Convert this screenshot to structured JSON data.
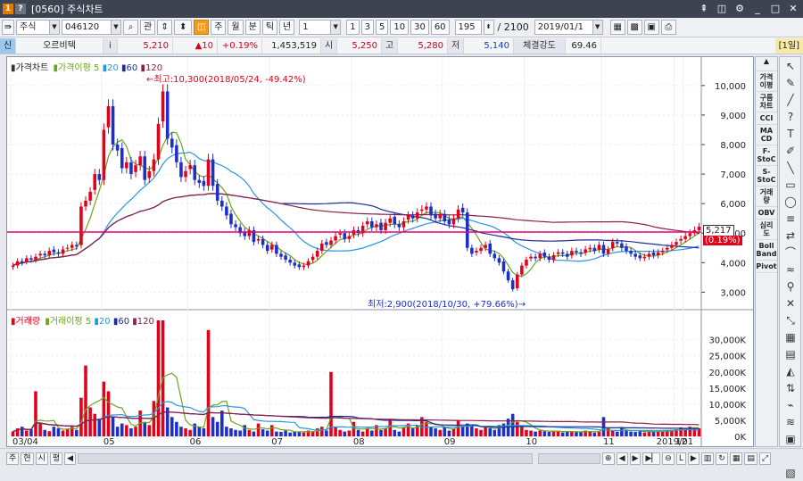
{
  "window": {
    "title": "[0560] 주식차트",
    "title_icon_1": "1",
    "title_icon_2": "?"
  },
  "toolbar": {
    "market": "주식",
    "code": "046120",
    "btn_gwan": "관",
    "periods": [
      "주",
      "월",
      "분",
      "틱",
      "년"
    ],
    "unit_value": "1",
    "minute_buttons": [
      "1",
      "3",
      "5",
      "10",
      "30",
      "60"
    ],
    "count_value": "195",
    "count_total": "/ 2100",
    "date_value": "2019/01/1"
  },
  "info": {
    "tag": "신",
    "name": "오르비텍",
    "i_label": "i",
    "price": "5,210",
    "change": "▲10",
    "change_pct": "+0.19%",
    "volume": "1,453,519",
    "open_label": "시",
    "open": "5,250",
    "high_label": "고",
    "high": "5,280",
    "low_label": "저",
    "low": "5,140",
    "strength_label": "체결강도",
    "strength": "69.46",
    "period_badge": "[1일]"
  },
  "price_panel": {
    "legend": {
      "name": "가격차트",
      "ma_name": "가격이평",
      "ma": [
        "5",
        "20",
        "60",
        "120"
      ]
    },
    "high_note": "←최고:10,300(2018/05/24, -49.42%)",
    "low_note": "최저:2,900(2018/10/30, +79.66%)→",
    "current_price_tag": "5,217",
    "current_pct_tag": "(0.19%)",
    "y_ticks": [
      "10,000",
      "9,000",
      "8,000",
      "7,000",
      "6,000",
      "5,000",
      "4,000",
      "3,000"
    ]
  },
  "volume_panel": {
    "legend": {
      "name": "거래량",
      "ma_name": "거래이평",
      "ma": [
        "5",
        "20",
        "60",
        "120"
      ]
    },
    "y_ticks": [
      "30,000K",
      "25,000K",
      "20,000K",
      "15,000K",
      "10,000K",
      "5,000K",
      "0K"
    ]
  },
  "x_labels": [
    "03/04",
    "05",
    "06",
    "07",
    "08",
    "09",
    "10",
    "11",
    "12",
    "2019/01"
  ],
  "right_tools": [
    "가격\n이평",
    "구름\n차트",
    "CCI",
    "MA\nCD",
    "F-\nStoC",
    "S-\nStoC",
    "거래\n량",
    "OBV",
    "심리\n도",
    "Boll\nBand",
    "Pivot"
  ],
  "drawing_tools": [
    "↖",
    "✎",
    "╱",
    "?",
    "T",
    "✐",
    "╲",
    "▭",
    "◯",
    "≡",
    "⇄",
    "⌒",
    "≈",
    "⚲",
    "✕",
    "⤡",
    "▦",
    "▤",
    "◭",
    "⇅",
    "⌁",
    "≋",
    "▣",
    "▥",
    "▧"
  ],
  "bottom": {
    "tabs": [
      "주",
      "현",
      "시",
      "평"
    ]
  },
  "chart_data": [
    {
      "type": "candlestick",
      "title": "가격차트",
      "ylim": [
        2800,
        10600
      ],
      "start_date": "2018/03/04",
      "end_date": "2019/01",
      "closes": [
        3900,
        4050,
        4000,
        4150,
        4100,
        4200,
        4300,
        4250,
        4400,
        4350,
        4300,
        4450,
        4500,
        4600,
        4550,
        5900,
        6100,
        6400,
        7000,
        6800,
        8500,
        9300,
        8000,
        7800,
        7200,
        7400,
        7000,
        7300,
        7600,
        6800,
        7100,
        7500,
        8700,
        9800,
        8200,
        7900,
        7400,
        6900,
        7100,
        7300,
        6800,
        6700,
        6600,
        7500,
        6600,
        6100,
        5900,
        5600,
        5300,
        5200,
        5000,
        4900,
        5100,
        4700,
        4800,
        4600,
        4400,
        4600,
        4300,
        4200,
        4100,
        4000,
        3900,
        3850,
        3900,
        4050,
        4200,
        4400,
        4650,
        4600,
        4750,
        4900,
        5000,
        4800,
        4900,
        5100,
        5000,
        5250,
        5400,
        5200,
        5300,
        5100,
        5350,
        5500,
        5300,
        5200,
        5400,
        5600,
        5500,
        5700,
        5800,
        5900,
        5600,
        5500,
        5650,
        5400,
        5300,
        5500,
        5800,
        5700,
        4500,
        4300,
        4400,
        4500,
        4600,
        4300,
        4150,
        4000,
        3700,
        3400,
        3100,
        3600,
        3900,
        4100,
        4200,
        4150,
        4300,
        4200,
        4100,
        4250,
        4350,
        4300,
        4200,
        4400,
        4350,
        4300,
        4450,
        4500,
        4400,
        4600,
        4300,
        4450,
        4700,
        4650,
        4500,
        4400,
        4300,
        4200,
        4150,
        4200,
        4300,
        4250,
        4350,
        4400,
        4500,
        4600,
        4700,
        4800,
        4900,
        5000,
        5100,
        5217
      ]
    },
    {
      "type": "bar",
      "title": "거래량",
      "ylim": [
        0,
        36000
      ],
      "values": [
        1500,
        2500,
        3000,
        1800,
        2200,
        14000,
        4000,
        2000,
        1600,
        3000,
        2500,
        1800,
        2400,
        3000,
        2000,
        12000,
        22000,
        9000,
        7000,
        5500,
        17000,
        14000,
        6000,
        3000,
        4000,
        3500,
        2500,
        3000,
        8000,
        4500,
        3500,
        11000,
        36000,
        36000,
        9000,
        6000,
        4500,
        3000,
        2500,
        2000,
        4000,
        3000,
        2500,
        33000,
        6000,
        4500,
        8000,
        3000,
        2500,
        2000,
        1800,
        3500,
        2000,
        1500,
        4000,
        2200,
        1800,
        3500,
        1500,
        1400,
        1800,
        1200,
        1500,
        1300,
        1200,
        1800,
        1500,
        2500,
        3000,
        1800,
        20000,
        3000,
        2000,
        1500,
        1800,
        4500,
        2000,
        1500,
        2500,
        1800,
        3500,
        2000,
        2500,
        5000,
        2000,
        1500,
        2800,
        4000,
        2500,
        3500,
        6000,
        4500,
        3000,
        2500,
        2000,
        3000,
        1800,
        2500,
        5000,
        3000,
        4000,
        3500,
        2500,
        2000,
        3000,
        2500,
        2000,
        3500,
        4000,
        5500,
        7000,
        4500,
        3000,
        2000,
        1800,
        1500,
        1800,
        1600,
        1400,
        1800,
        1500,
        1200,
        1600,
        1400,
        1500,
        1300,
        1800,
        1500,
        1200,
        1600,
        6000,
        2500,
        1800,
        1500,
        2500,
        1800,
        1500,
        1400,
        1600,
        1200,
        1800,
        1500,
        1700,
        1500,
        1800,
        2000,
        2200,
        2800,
        2500,
        3000,
        2800,
        2500
      ]
    }
  ],
  "colors": {
    "up": "#e2001b",
    "down": "#1c2fc9",
    "ma5": "#6aa51f",
    "ma20": "#2a95e0",
    "ma60": "#1d2a9a",
    "ma120": "#8a1f48",
    "hline": "#e8007a"
  }
}
